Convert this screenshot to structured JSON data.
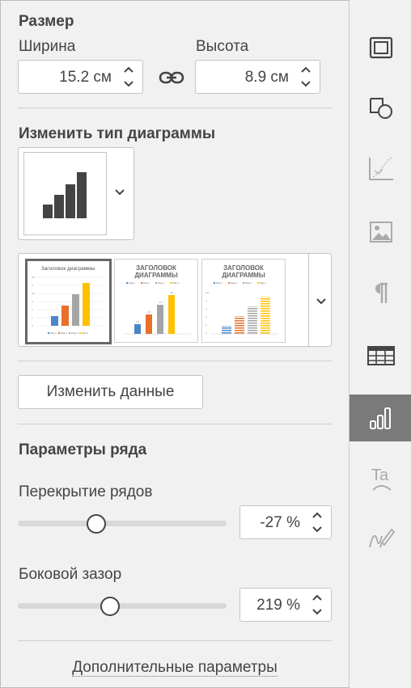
{
  "size": {
    "title": "Размер",
    "width_label": "Ширина",
    "height_label": "Высота",
    "width_value": "15.2 см",
    "height_value": "8.9 см"
  },
  "chart_type": {
    "title": "Изменить тип диаграммы",
    "selected_type": "column-chart",
    "styles": [
      {
        "title": "Заголовок диаграммы",
        "fill": "solid",
        "colors": [
          "#4a86c8",
          "#e8702a",
          "#a5a5a5",
          "#ffc000"
        ],
        "legend": [
          "Ряд 1",
          "Ряд 2",
          "Ряд 3",
          "Ряд 4"
        ]
      },
      {
        "title": "ЗАГОЛОВОК ДИАГРАММЫ",
        "fill": "solid",
        "colors": [
          "#4a86c8",
          "#e8702a",
          "#a5a5a5",
          "#ffc000"
        ],
        "legend": [
          "Ряд 1",
          "Ряд 2",
          "Ряд 3",
          "Ряд 4"
        ]
      },
      {
        "title": "ЗАГОЛОВОК ДИАГРАММЫ",
        "fill": "striped",
        "colors": [
          "#4a86c8",
          "#e8702a",
          "#a5a5a5",
          "#ffc000"
        ],
        "legend": [
          "Ряд 1",
          "Ряд 2",
          "Ряд 3",
          "Ряд 4"
        ]
      }
    ]
  },
  "edit_data_label": "Изменить данные",
  "series": {
    "title": "Параметры ряда",
    "overlap_label": "Перекрытие рядов",
    "overlap_value": "-27 %",
    "overlap_level": -27,
    "gap_label": "Боковой зазор",
    "gap_value": "219 %",
    "gap_level": 219
  },
  "advanced_link": "Дополнительные параметры",
  "rail_icons": [
    "slide-settings-icon",
    "shape-settings-icon",
    "text-art-icon",
    "image-settings-icon",
    "paragraph-settings-icon",
    "table-settings-icon",
    "chart-settings-icon",
    "text-art-settings-icon",
    "signature-settings-icon"
  ],
  "colors": {
    "accent_active": "#7a7a7a",
    "selected_border": "#666666"
  }
}
